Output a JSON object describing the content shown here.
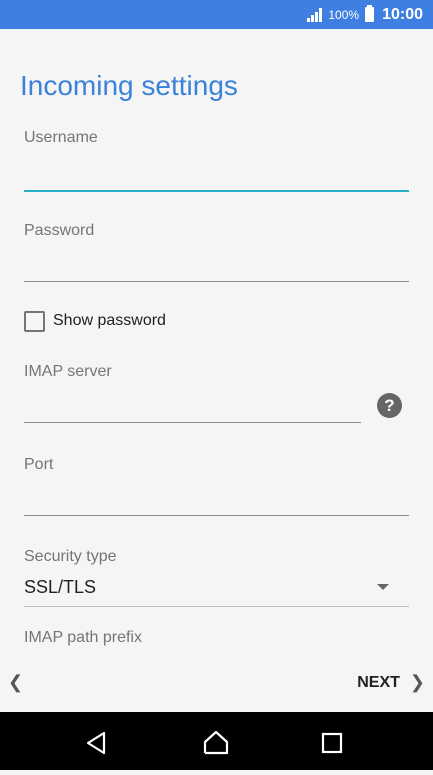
{
  "status_bar": {
    "battery_text": "100%",
    "time": "10:00",
    "signal_icon": "signal-bars-icon",
    "battery_icon": "battery-icon",
    "color": "#3e7fe1"
  },
  "page": {
    "title": "Incoming settings",
    "title_color": "#3b82db",
    "accent_color": "#26b3c6"
  },
  "fields": {
    "username": {
      "label": "Username",
      "value": ""
    },
    "password": {
      "label": "Password",
      "value": ""
    },
    "show_password": {
      "label": "Show password",
      "checked": false
    },
    "imap_server": {
      "label": "IMAP server",
      "value": "",
      "help_icon": "?"
    },
    "port": {
      "label": "Port",
      "value": ""
    },
    "security_type": {
      "label": "Security type",
      "value": "SSL/TLS"
    },
    "imap_path_prefix": {
      "label": "IMAP path prefix"
    }
  },
  "footer": {
    "back_icon": "chevron-left-icon",
    "next_label": "NEXT",
    "next_icon": "chevron-right-icon"
  },
  "system_nav": {
    "icons": [
      "back-triangle-icon",
      "home-icon",
      "recents-square-icon"
    ]
  }
}
